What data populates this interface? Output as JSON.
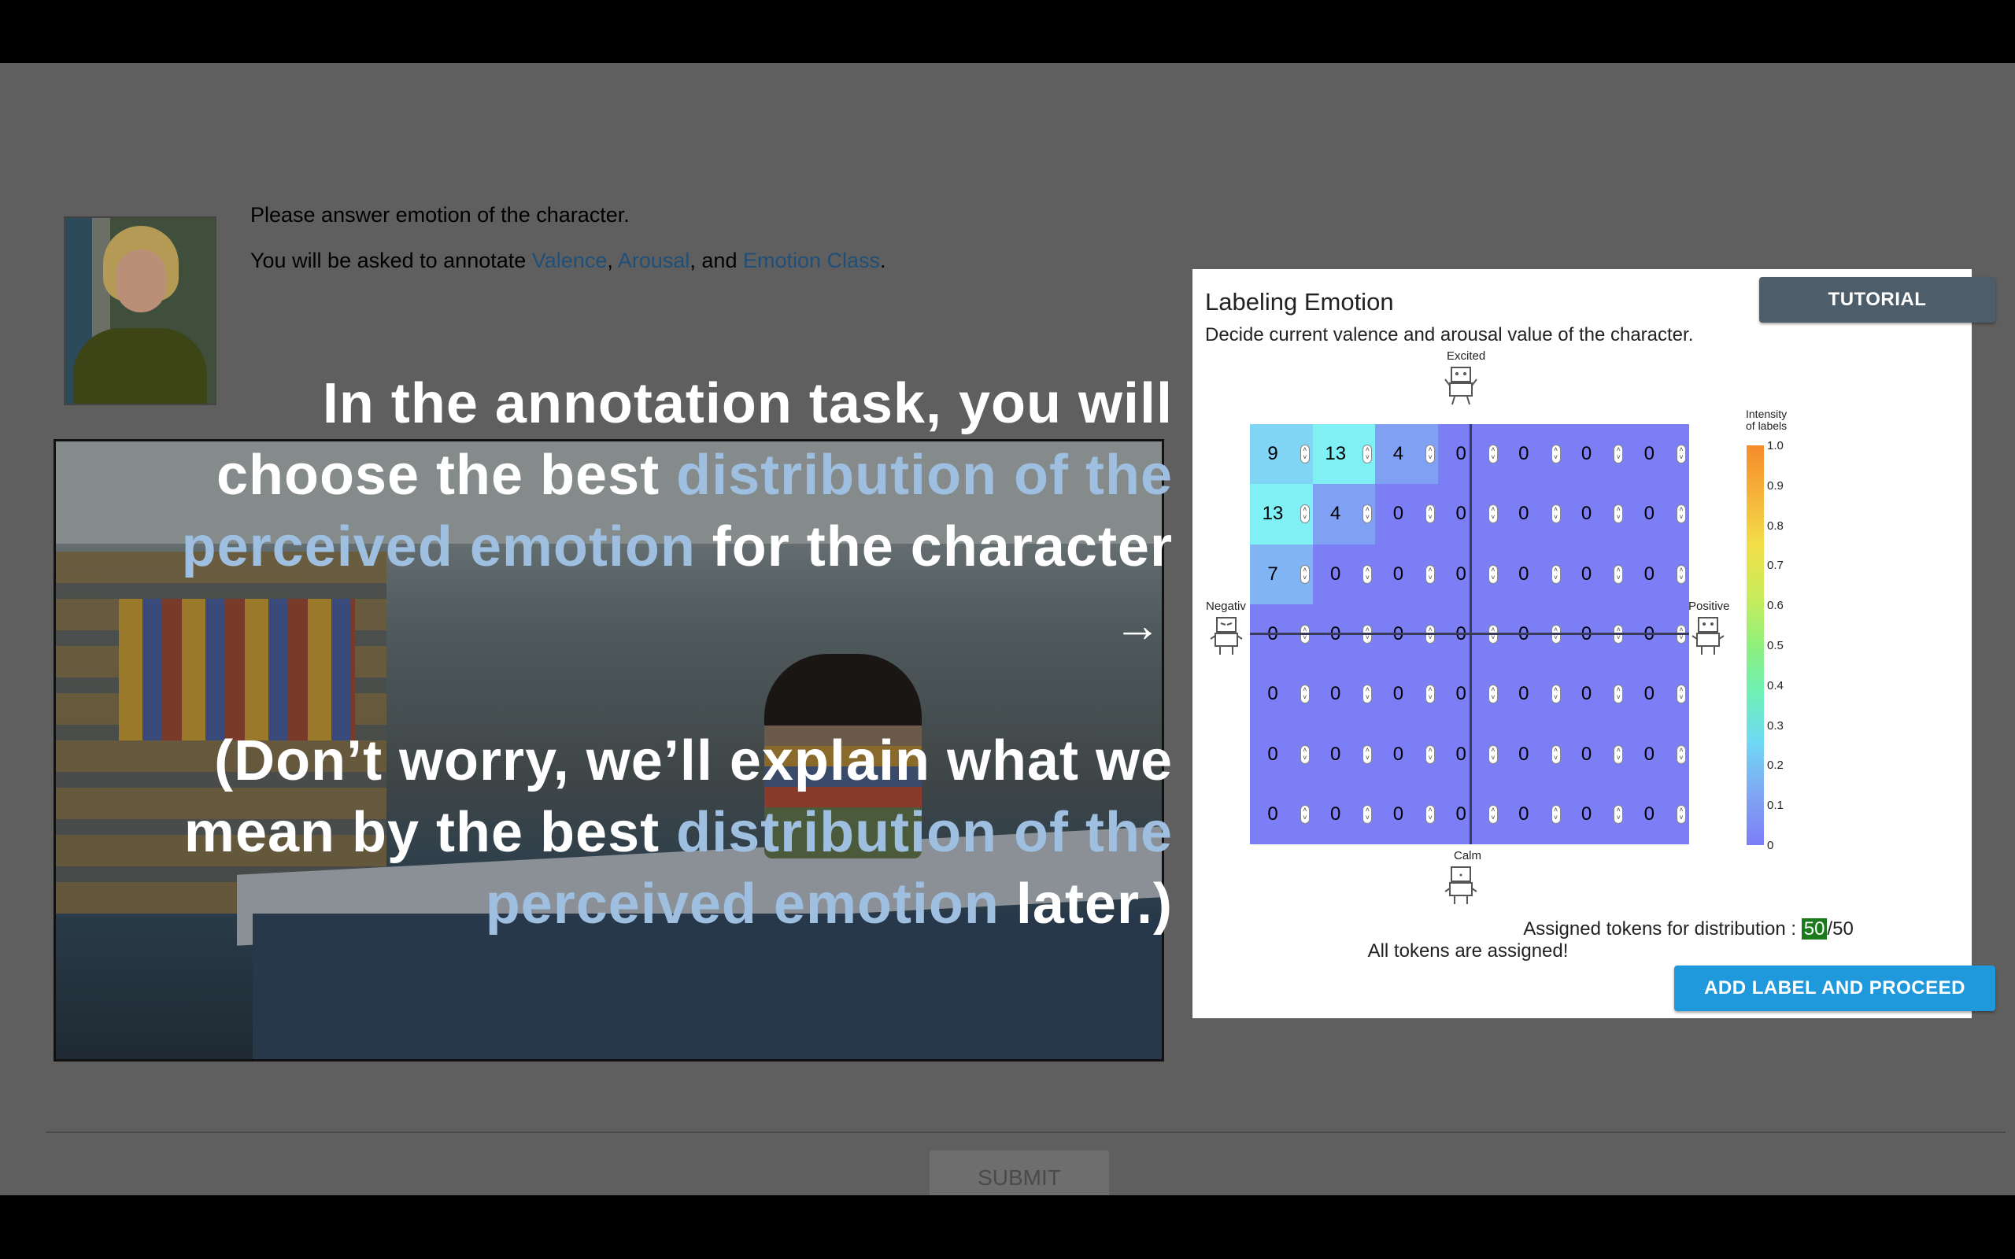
{
  "prompt": {
    "line1": "Please answer emotion of the character.",
    "line2_prefix": "You will be asked to annotate ",
    "valence": "Valence",
    "sep1": ", ",
    "arousal": "Arousal",
    "sep2": ", and ",
    "emotion_class": "Emotion Class",
    "line2_suffix": "."
  },
  "overlay": {
    "p1_line1": "In the annotation task, you will",
    "p1_line2_plain": "choose the best ",
    "p1_line2_hl": "distribution of the",
    "p1_line3_hl": "perceived emotion",
    "p1_line3_plain": " for the character",
    "arrow": "→",
    "p2_line1": "(Don’t worry, we’ll explain what we",
    "p2_line2_plain": "mean by the best ",
    "p2_line2_hl": "distribution of the",
    "p2_line3_hl": "perceived emotion",
    "p2_line3_plain": " later.)"
  },
  "panel": {
    "title": "Labeling Emotion",
    "subtitle": "Decide current valence and arousal value of the character.",
    "tutorial_button": "TUTORIAL",
    "add_button": "ADD LABEL AND PROCEED",
    "labels": {
      "top": "Excited",
      "bottom": "Calm",
      "left": "Negativ",
      "right": "Positive"
    },
    "colorbar_title_1": "Intensity",
    "colorbar_title_2": "of labels",
    "colorbar_ticks": [
      "1.0",
      "0.9",
      "0.8",
      "0.7",
      "0.6",
      "0.5",
      "0.4",
      "0.3",
      "0.2",
      "0.1",
      "0"
    ],
    "tokens_label": "Assigned tokens for distribution : ",
    "tokens_assigned": "50",
    "tokens_total": "/50",
    "tokens_status": "All tokens are assigned!"
  },
  "grid": [
    [
      9,
      13,
      4,
      0,
      0,
      0,
      0
    ],
    [
      13,
      4,
      0,
      0,
      0,
      0,
      0
    ],
    [
      7,
      0,
      0,
      0,
      0,
      0,
      0
    ],
    [
      0,
      0,
      0,
      0,
      0,
      0,
      0
    ],
    [
      0,
      0,
      0,
      0,
      0,
      0,
      0
    ],
    [
      0,
      0,
      0,
      0,
      0,
      0,
      0
    ],
    [
      0,
      0,
      0,
      0,
      0,
      0,
      0
    ]
  ],
  "submit_label": "SUBMIT"
}
